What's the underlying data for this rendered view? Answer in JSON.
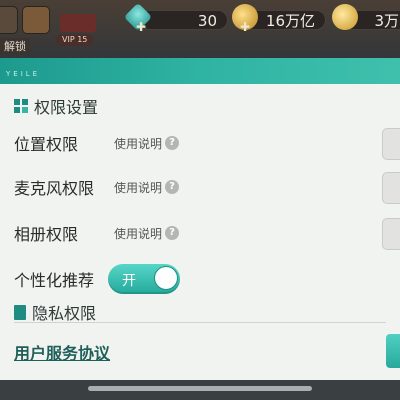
{
  "hud": {
    "vip_badge": "VIP 15",
    "unlock_label": "解锁",
    "gems": "30",
    "gold": "16万亿",
    "coins": "3万"
  },
  "dialog": {
    "brand": "YEILE",
    "permissions_title": "权限设置",
    "rows": [
      {
        "name": "位置权限",
        "help": "使用说明"
      },
      {
        "name": "麦克风权限",
        "help": "使用说明"
      },
      {
        "name": "相册权限",
        "help": "使用说明"
      }
    ],
    "personalized": {
      "name": "个性化推荐",
      "switch_label": "开",
      "state": "on"
    },
    "privacy_title": "隐私权限",
    "agreement_link": "用户服务协议"
  },
  "colors": {
    "accent": "#2fb3a2",
    "link": "#1f5f59"
  }
}
